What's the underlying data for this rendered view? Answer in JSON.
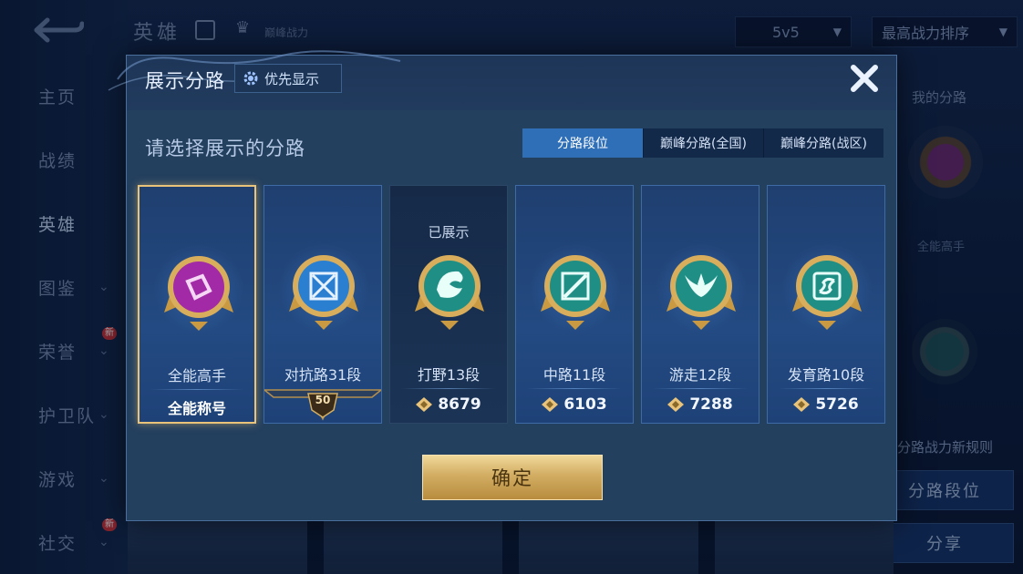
{
  "background": {
    "nav_items": [
      {
        "label": "主页",
        "chevron": false,
        "new": false
      },
      {
        "label": "战绩",
        "chevron": false,
        "new": false
      },
      {
        "label": "英雄",
        "chevron": false,
        "new": false,
        "active": true
      },
      {
        "label": "图鉴",
        "chevron": true,
        "new": false
      },
      {
        "label": "荣誉",
        "chevron": true,
        "new": true
      },
      {
        "label": "护卫队",
        "chevron": true,
        "new": false
      },
      {
        "label": "游戏",
        "chevron": true,
        "new": false
      },
      {
        "label": "社交",
        "chevron": true,
        "new": true
      }
    ],
    "new_badge": "新",
    "top_title": "英雄",
    "peak_label": "巅峰战力",
    "mode_select": "5v5",
    "sort_select": "最高战力排序",
    "my_route": "我的分路",
    "right_label": "全能高手",
    "rule_link": "分路战力新规则",
    "route_rank_button": "分路段位",
    "share_button": "分享"
  },
  "dialog": {
    "title": "展示分路",
    "priority_button": "优先显示",
    "subtitle": "请选择展示的分路",
    "tabs": [
      {
        "label": "分路段位",
        "active": true
      },
      {
        "label": "巅峰分路(全国)",
        "active": false
      },
      {
        "label": "巅峰分路(战区)",
        "active": false
      }
    ],
    "cards": [
      {
        "name": "全能高手",
        "footer": "全能称号",
        "type": "title",
        "emblem": "all-round",
        "selected": true
      },
      {
        "name": "对抗路31段",
        "footer": "50",
        "type": "level",
        "emblem": "clash-lane"
      },
      {
        "name": "打野13段",
        "footer": "8679",
        "type": "score",
        "emblem": "jungle",
        "shown_label": "已展示",
        "shown": true
      },
      {
        "name": "中路11段",
        "footer": "6103",
        "type": "score",
        "emblem": "mid-lane"
      },
      {
        "name": "游走12段",
        "footer": "7288",
        "type": "score",
        "emblem": "roam"
      },
      {
        "name": "发育路10段",
        "footer": "5726",
        "type": "score",
        "emblem": "farm-lane"
      }
    ],
    "confirm_button": "确定"
  },
  "colors": {
    "accent_blue": "#2f6fb8",
    "gold": "#d2ad62",
    "selected_border": "#e9c37a",
    "emblem_purple": "#a02aa0",
    "emblem_teal": "#1f8f86",
    "emblem_blue": "#2a7fd1"
  }
}
